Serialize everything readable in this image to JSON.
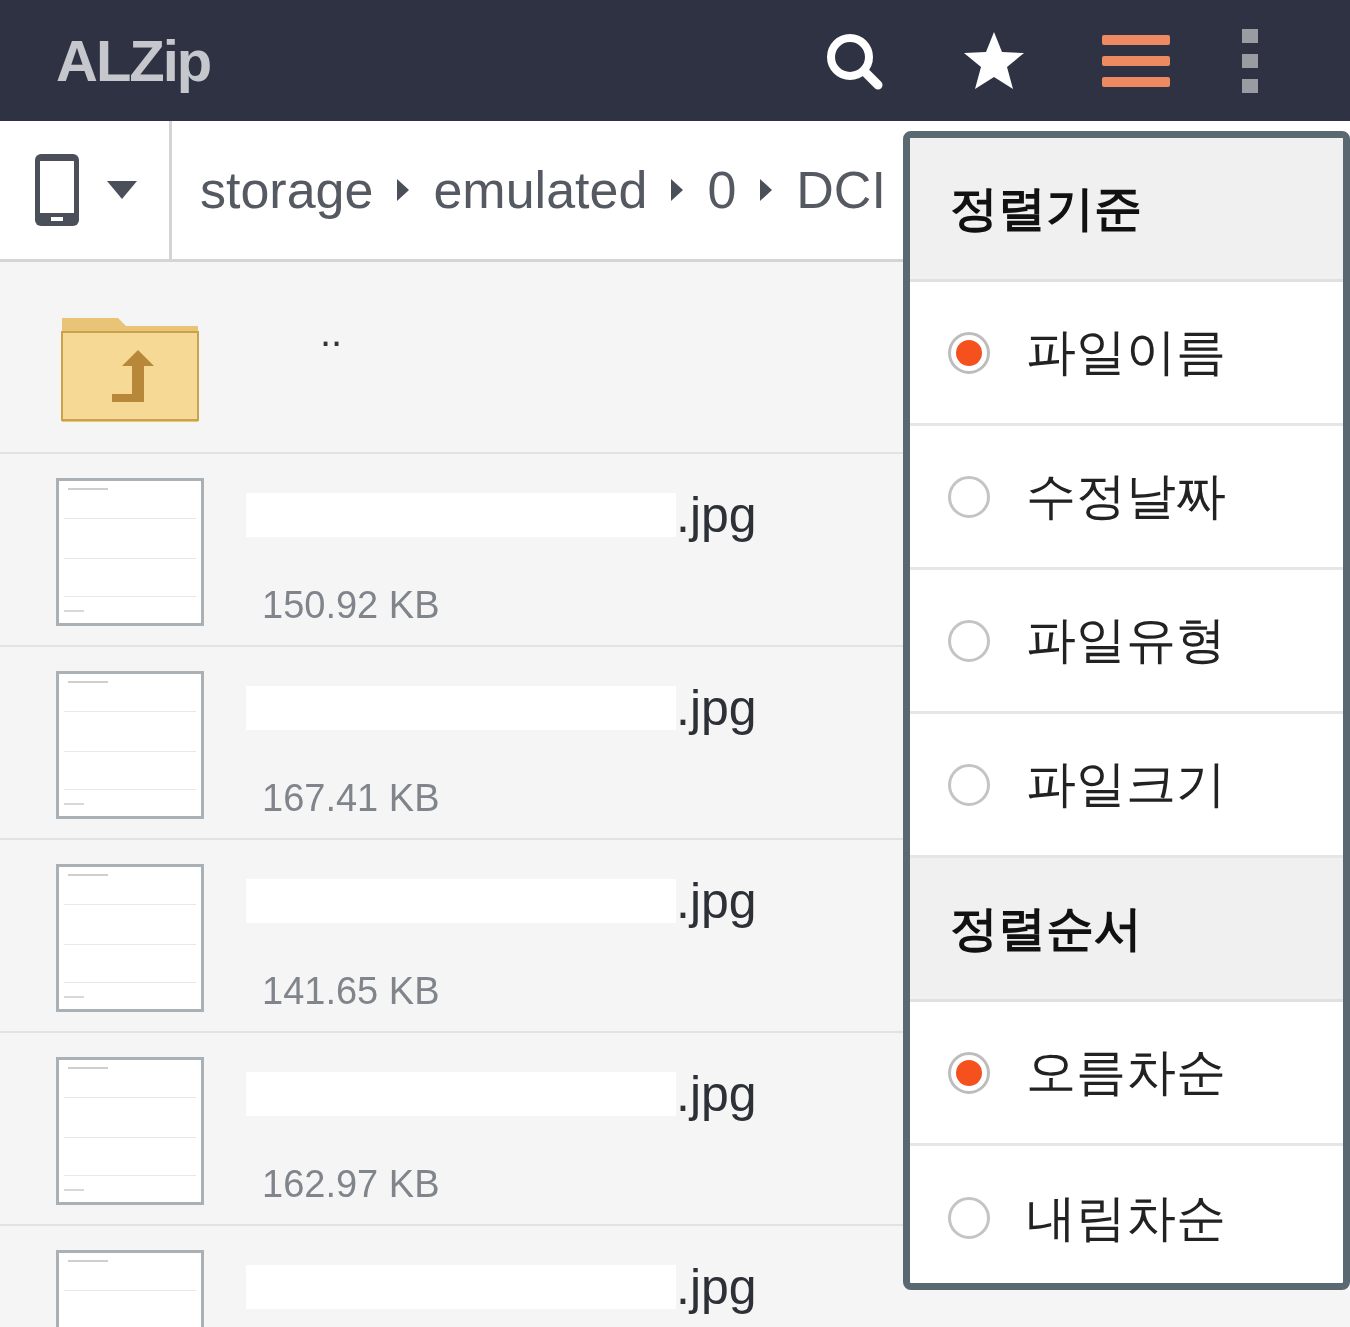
{
  "app_bar": {
    "title": "ALZip",
    "actions": [
      {
        "kind": "search",
        "selected": false
      },
      {
        "kind": "favorites",
        "selected": false
      },
      {
        "kind": "sort",
        "selected": true
      },
      {
        "kind": "more",
        "selected": false
      }
    ]
  },
  "breadcrumb": {
    "path": [
      "storage",
      "emulated",
      "0",
      "DCI"
    ]
  },
  "files": [
    {
      "kind": "parent",
      "name": ".."
    },
    {
      "name": ".jpg",
      "size": "150.92 KB"
    },
    {
      "name": ".jpg",
      "size": "167.41 KB"
    },
    {
      "name": ".jpg",
      "size": "141.65 KB"
    },
    {
      "name": ".jpg",
      "size": "162.97 KB"
    },
    {
      "name": ".jpg"
    }
  ],
  "sort_menu": {
    "sections": [
      {
        "title": "정렬기준",
        "options": [
          {
            "label": "파일이름",
            "selected": true
          },
          {
            "label": "수정날짜",
            "selected": false
          },
          {
            "label": "파일유형",
            "selected": false
          },
          {
            "label": "파일크기",
            "selected": false
          }
        ]
      },
      {
        "title": "정렬순서",
        "options": [
          {
            "label": "오름차순",
            "selected": true
          },
          {
            "label": "내림차순",
            "selected": false
          }
        ]
      }
    ]
  }
}
